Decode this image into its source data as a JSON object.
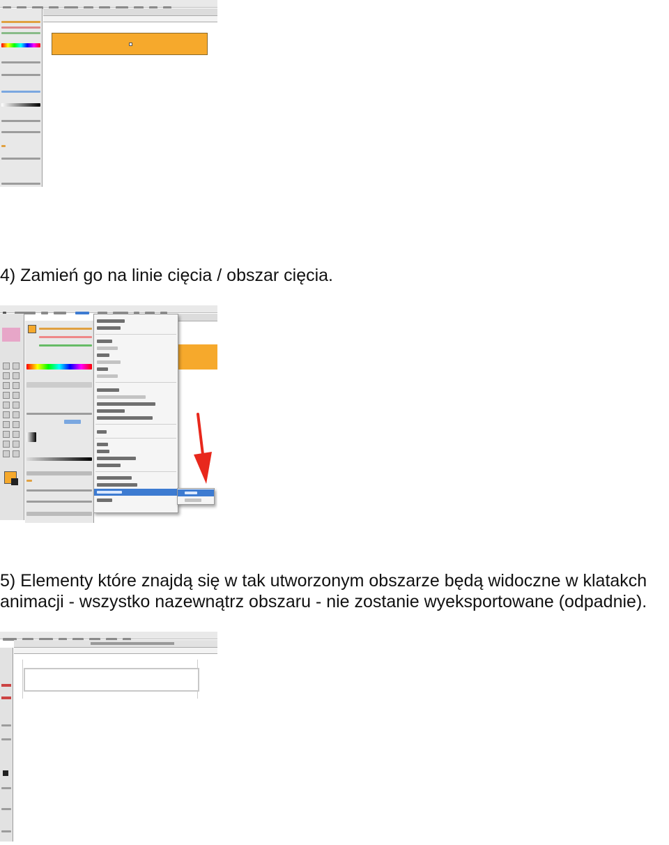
{
  "steps": {
    "step4": "4) Zamień go na linie cięcia / obszar cięcia.",
    "step5_line1": "5) Elementy które znajdą się w tak utworzonym obszarze będą widoczne w klatakch",
    "step5_line2": "animacji - wszystko nazewnątrz obszaru - nie zostanie wyeksportowane (odpadnie)."
  },
  "colors": {
    "orange": "#f6a92c",
    "menu_highlight": "#3d7bd1",
    "arrow": "#e8281c"
  },
  "icons": {
    "apple": "apple-logo-icon",
    "arrow": "red-arrow-icon"
  }
}
